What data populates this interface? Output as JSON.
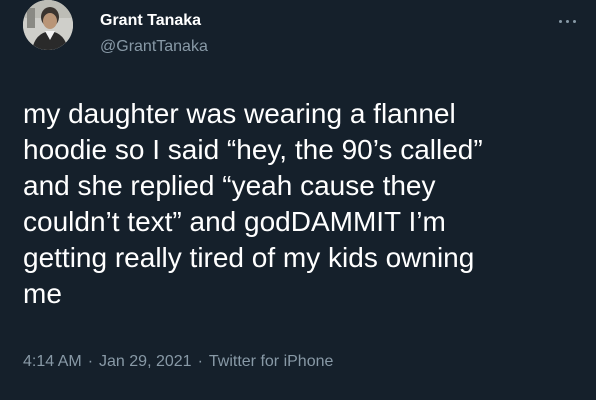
{
  "tweet": {
    "author": {
      "name": "Grant Tanaka",
      "handle": "@GrantTanaka"
    },
    "text_lines": [
      "my daughter was wearing a flannel",
      "hoodie so I said “hey, the 90’s called”",
      "and she replied “yeah cause they",
      "couldn’t text” and godDAMMIT I’m",
      "getting really tired of my kids owning",
      "me"
    ],
    "time": "4:14 AM",
    "date": "Jan 29, 2021",
    "source": "Twitter for iPhone",
    "separator": "·",
    "more_icon": "more-horizontal-icon"
  },
  "colors": {
    "background": "#15202b",
    "primary_text": "#ffffff",
    "secondary_text": "#8899a6"
  }
}
